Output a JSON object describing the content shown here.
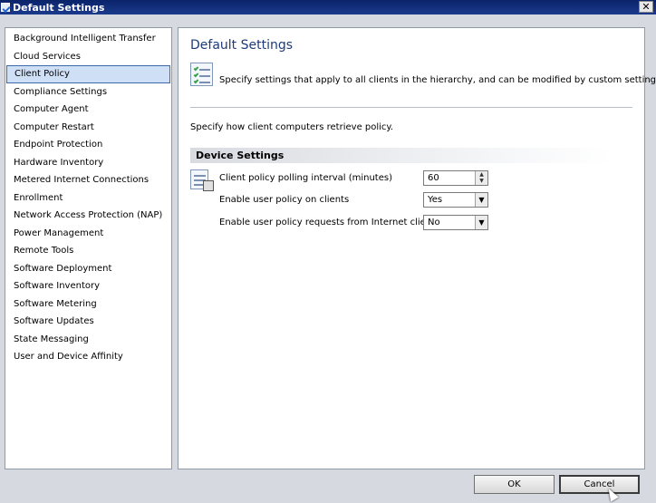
{
  "window": {
    "title": "Default Settings",
    "close_glyph": "✕"
  },
  "sidebar": {
    "items": [
      {
        "label": "Background Intelligent Transfer"
      },
      {
        "label": "Cloud Services"
      },
      {
        "label": "Client Policy",
        "selected": true
      },
      {
        "label": "Compliance Settings"
      },
      {
        "label": "Computer Agent"
      },
      {
        "label": "Computer Restart"
      },
      {
        "label": "Endpoint Protection"
      },
      {
        "label": "Hardware Inventory"
      },
      {
        "label": "Metered Internet Connections"
      },
      {
        "label": "Enrollment"
      },
      {
        "label": "Network Access Protection (NAP)"
      },
      {
        "label": "Power Management"
      },
      {
        "label": "Remote Tools"
      },
      {
        "label": "Software Deployment"
      },
      {
        "label": "Software Inventory"
      },
      {
        "label": "Software Metering"
      },
      {
        "label": "Software Updates"
      },
      {
        "label": "State Messaging"
      },
      {
        "label": "User and Device Affinity"
      }
    ]
  },
  "main": {
    "title": "Default Settings",
    "intro": "Specify settings that apply to all clients in the hierarchy, and can be modified by custom settings.",
    "description": "Specify how client computers retrieve policy.",
    "group_title": "Device Settings",
    "settings": [
      {
        "label": "Client policy polling interval (minutes)",
        "value": "60",
        "control": "spinner"
      },
      {
        "label": "Enable user policy on clients",
        "value": "Yes",
        "control": "dropdown"
      },
      {
        "label": "Enable user policy requests from Internet clients",
        "value": "No",
        "control": "dropdown"
      }
    ]
  },
  "footer": {
    "ok_label": "OK",
    "cancel_label": "Cancel"
  },
  "colors": {
    "title_bar": "#0a246a",
    "selection": "#cfe0f6",
    "heading": "#1f3a7a"
  }
}
